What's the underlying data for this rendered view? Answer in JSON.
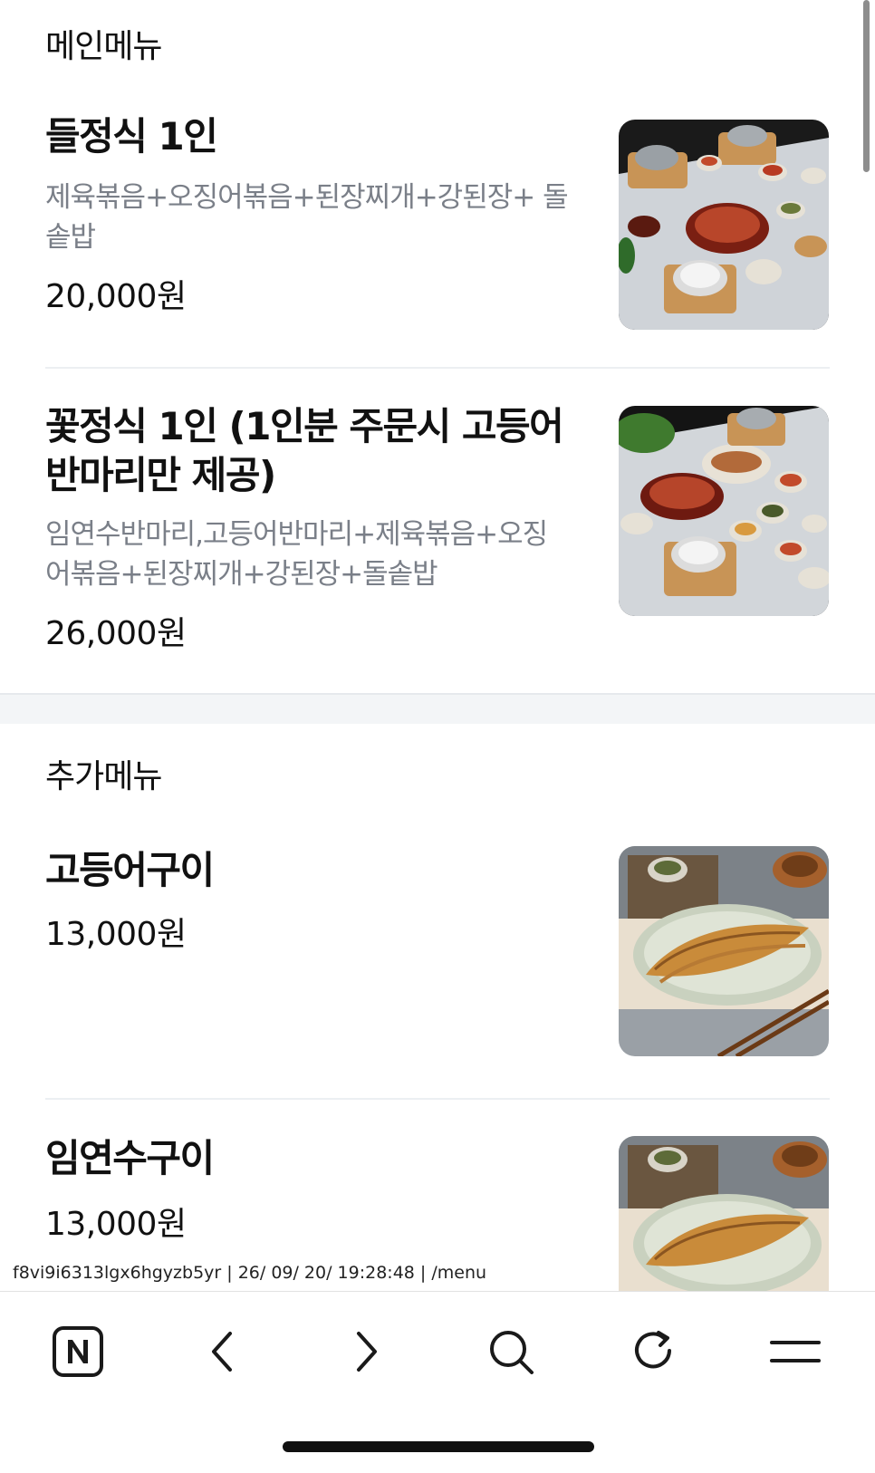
{
  "sections": {
    "main": {
      "title": "메인메뉴",
      "items": [
        {
          "name": "들정식 1인",
          "description": "제육볶음+오징어볶음+된장찌개+강된장+ 돌솥밥",
          "price": "20,000원",
          "image": "korean-set-meal-photo"
        },
        {
          "name": "꽃정식 1인 (1인분 주문시 고등어반마리만 제공)",
          "description": "임연수반마리,고등어반마리+제육볶음+오징어볶음+된장찌개+강된장+돌솥밥",
          "price": "26,000원",
          "image": "korean-flower-set-photo"
        }
      ]
    },
    "extra": {
      "title": "추가메뉴",
      "items": [
        {
          "name": "고등어구이",
          "price": "13,000원",
          "image": "grilled-mackerel-photo"
        },
        {
          "name": "임연수구이",
          "price": "13,000원",
          "image": "grilled-atka-mackerel-photo"
        }
      ]
    }
  },
  "url_overlay": "f8vi9i6313lgx6hgyzb5yr | 26/ 09/ 20/ 19:28:48 | /menu",
  "toolbar": {
    "buttons": [
      {
        "icon": "naver-home-icon"
      },
      {
        "icon": "back-arrow-icon"
      },
      {
        "icon": "forward-arrow-icon"
      },
      {
        "icon": "search-icon"
      },
      {
        "icon": "refresh-icon"
      },
      {
        "icon": "menu-icon"
      }
    ]
  }
}
